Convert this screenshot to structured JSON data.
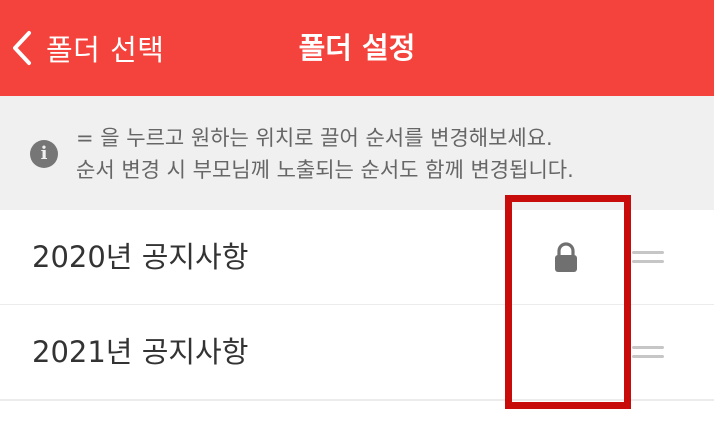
{
  "header": {
    "back_label": "폴더 선택",
    "title": "폴더 설정"
  },
  "notice": {
    "icon": "info-icon",
    "line1": "= 을 누르고 원하는 위치로 끌어 순서를 변경해보세요.",
    "line2": "순서 변경 시 부모님께 노출되는 순서도 함께 변경됩니다."
  },
  "folders": [
    {
      "name": "2020년 공지사항",
      "locked": true
    },
    {
      "name": "2021년 공지사항",
      "locked": false
    }
  ],
  "colors": {
    "header_bg": "#f4433c",
    "notice_bg": "#f0f0f0",
    "highlight_border": "#c80c0c"
  }
}
